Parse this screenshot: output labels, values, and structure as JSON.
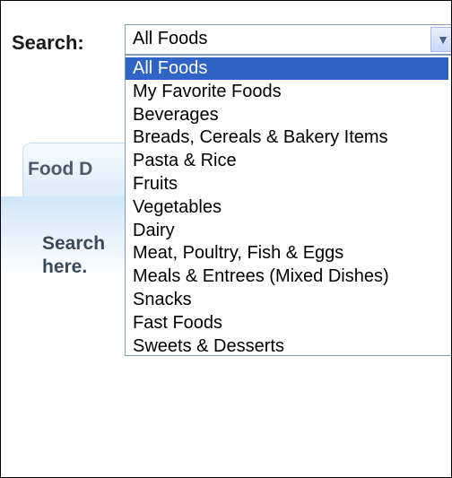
{
  "search": {
    "label": "Search:",
    "selected_value": "All Foods",
    "arrow_icon": "chevron-down-icon"
  },
  "tab": {
    "label": "Food D"
  },
  "hint": {
    "line1": "Search",
    "line2": "here."
  },
  "dropdown": {
    "options": [
      "All Foods",
      "My Favorite Foods",
      "Beverages",
      "Breads, Cereals & Bakery Items",
      "Pasta & Rice",
      "Fruits",
      "Vegetables",
      "Dairy",
      "Meat, Poultry, Fish & Eggs",
      "Meals & Entrees (Mixed Dishes)",
      "Snacks",
      "Fast Foods",
      "Sweets & Desserts"
    ],
    "highlighted_option": "All Foods"
  },
  "colors": {
    "highlight": "#3063c6",
    "select_border": "#7f9db9",
    "panel_gradient_top": "#cfe6f8"
  }
}
